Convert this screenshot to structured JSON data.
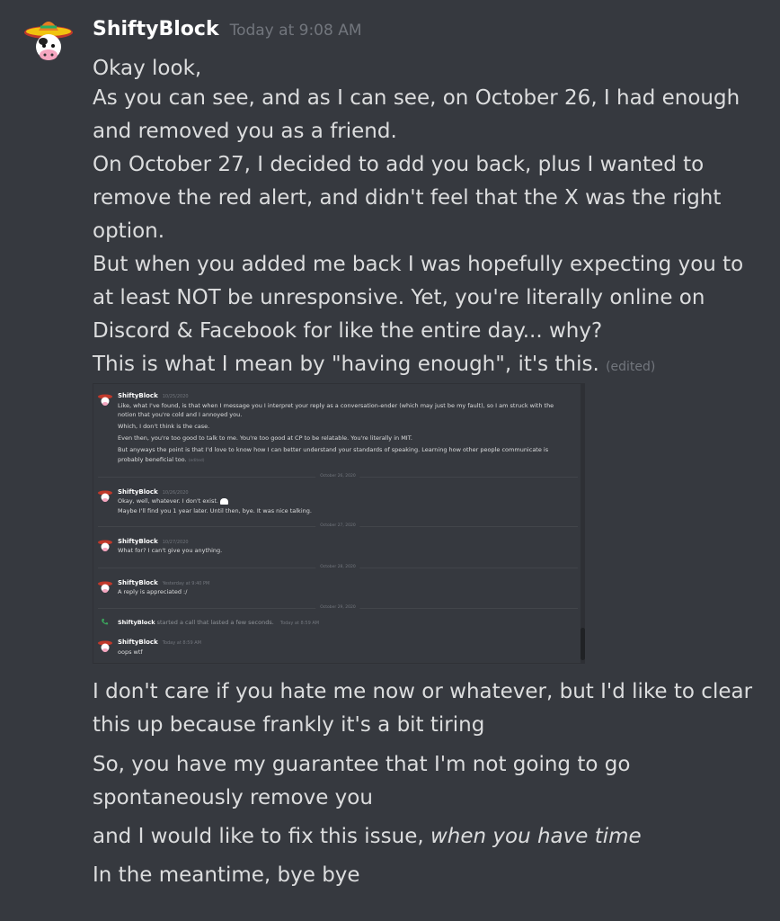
{
  "message": {
    "author": "ShiftyBlock",
    "timestamp": "Today at 9:08 AM",
    "lines": [
      "Okay look,",
      "As you can see, and as I can see, on October 26, I had enough and removed you as a friend.",
      "On October 27, I decided to add you back, plus I wanted to remove the red alert, and didn't feel that the X was the right option.",
      "But when you added me back I was hopefully expecting you to at least NOT be unresponsive. Yet, you're literally online on Discord & Facebook for like the entire day... why?",
      "This is what I mean by \"having enough\", it's this."
    ],
    "edited": "(edited)"
  },
  "embed": {
    "messages": [
      {
        "author": "ShiftyBlock",
        "timestamp": "10/25/2020",
        "lines": [
          "Like, what I've found, is that when I message you I interpret your reply as a conversation-ender (which may just be my fault), so I am struck with the",
          "notion that you're cold and I annoyed you.",
          "Which, I don't think is the case.",
          "Even then, you're too good to talk to me. You're too good at CP to be relatable. You're literally in MIT.",
          "But anyways the point is that I'd love to know how I can better understand your standards of speaking.  Learning how other people communicate is",
          "probably beneficial too."
        ],
        "edited": "(edited)"
      },
      {
        "divider": "October 26, 2020"
      },
      {
        "author": "ShiftyBlock",
        "timestamp": "10/26/2020",
        "lines": [
          "Okay, well, whatever. I don't exist.",
          "Maybe I'll find you 1 year later. Until then, bye. It was nice talking."
        ]
      },
      {
        "divider": "October 27, 2020"
      },
      {
        "author": "ShiftyBlock",
        "timestamp": "10/27/2020",
        "lines": [
          "What for? I can't give you anything."
        ]
      },
      {
        "divider": "October 28, 2020"
      },
      {
        "author": "ShiftyBlock",
        "timestamp": "Yesterday at 9:40 PM",
        "lines": [
          "A reply is appreciated :/"
        ]
      },
      {
        "divider": "October 29, 2020"
      },
      {
        "call_author": "ShiftyBlock",
        "call_text": "started a call that lasted a few seconds.",
        "call_ts": "Today at 8:59 AM"
      },
      {
        "author": "ShiftyBlock",
        "timestamp": "Today at 8:59 AM",
        "lines": [
          "oops wtf"
        ]
      }
    ]
  },
  "followups": [
    "I don't care if you hate me now or whatever, but I'd like to clear this up because frankly it's a bit tiring",
    "So, you have my guarantee that I'm not going to go spontaneously remove you",
    {
      "text": "and I would like to fix this issue, ",
      "italic": "when you have time"
    },
    "In the meantime, bye bye"
  ],
  "icons": {
    "avatar": "sombrero-cow-avatar-icon",
    "call": "phone-icon"
  },
  "colors": {
    "background": "#36393f",
    "username": "#ffffff",
    "text": "#dcddde",
    "muted": "#72767d",
    "call": "#3ba55c"
  }
}
